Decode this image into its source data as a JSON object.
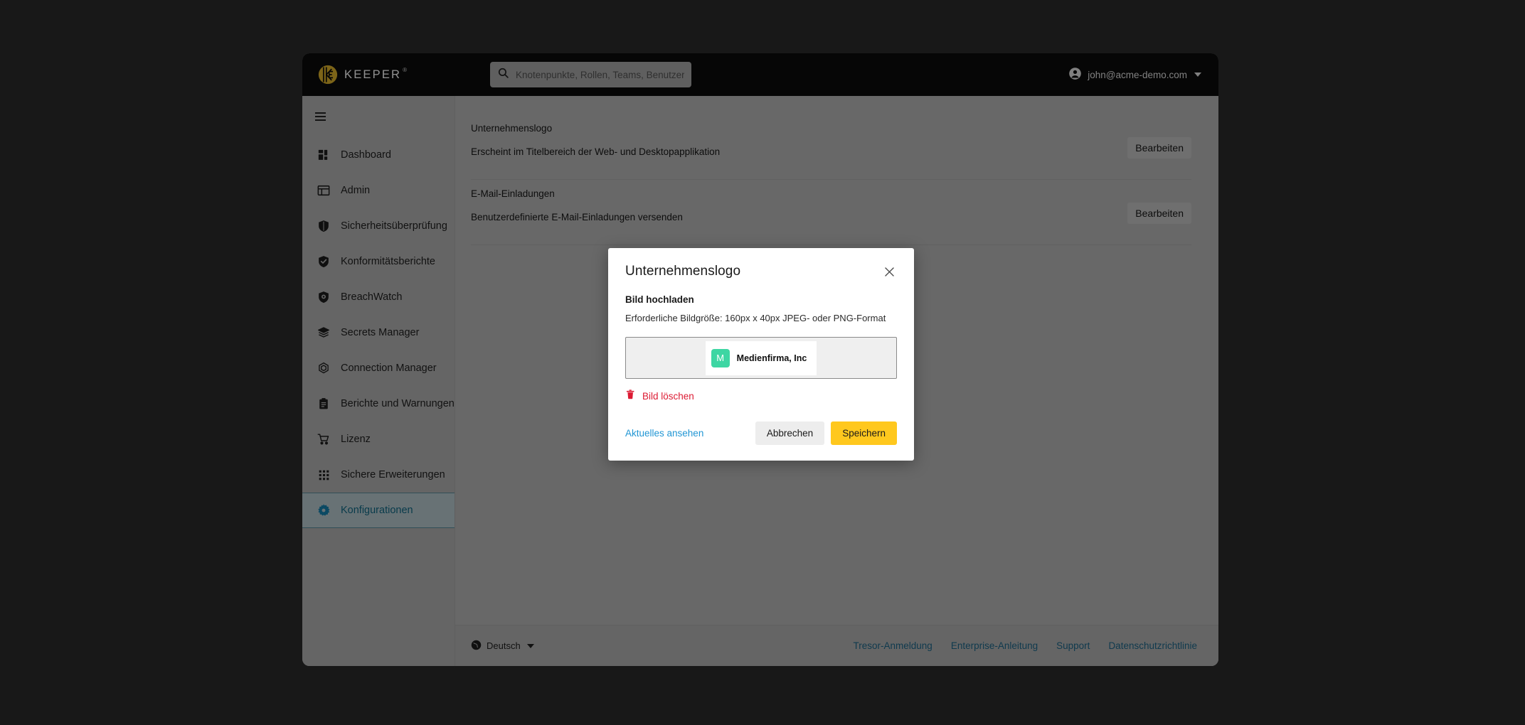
{
  "brand": {
    "name": "KEEPER",
    "trademark": "®",
    "logo_color": "#c9a227"
  },
  "topbar": {
    "search": {
      "placeholder": "Knotenpunkte, Rollen, Teams, Benutzer",
      "value": "",
      "icon": "search-icon"
    },
    "user": {
      "email": "john@acme-demo.com",
      "avatar_icon": "user-circle-icon",
      "caret_icon": "chevron-down-icon"
    }
  },
  "sidebar": {
    "menu_icon": "hamburger-icon",
    "items": [
      {
        "label": "Dashboard",
        "icon": "dashboard-grid-icon",
        "active": false
      },
      {
        "label": "Admin",
        "icon": "layout-panel-icon",
        "active": false
      },
      {
        "label": "Sicherheitsüberprüfung",
        "icon": "shield-icon",
        "active": false
      },
      {
        "label": "Konformitätsberichte",
        "icon": "shield-check-icon",
        "active": false
      },
      {
        "label": "BreachWatch",
        "icon": "shield-eye-icon",
        "active": false
      },
      {
        "label": "Secrets Manager",
        "icon": "layers-icon",
        "active": false
      },
      {
        "label": "Connection Manager",
        "icon": "hexagon-icon",
        "active": false
      },
      {
        "label": "Berichte und Warnungen",
        "icon": "clipboard-icon",
        "active": false
      },
      {
        "label": "Lizenz",
        "icon": "shopping-cart-icon",
        "active": false
      },
      {
        "label": "Sichere Erweiterungen",
        "icon": "grid-dots-icon",
        "active": false
      },
      {
        "label": "Konfigurationen",
        "icon": "gear-icon",
        "active": true
      }
    ],
    "active_color": "#0e5f7a"
  },
  "main": {
    "rows": [
      {
        "title": "Unternehmenslogo",
        "description": "Erscheint im Titelbereich der Web- und Desktopapplikation",
        "action_label": "Bearbeiten"
      },
      {
        "title": "E-Mail-Einladungen",
        "description": "Benutzerdefinierte E-Mail-Einladungen versenden",
        "action_label": "Bearbeiten"
      }
    ]
  },
  "footer": {
    "language": {
      "label": "Deutsch",
      "icon": "globe-icon",
      "caret_icon": "chevron-down-icon"
    },
    "links": [
      {
        "label": "Tresor-Anmeldung"
      },
      {
        "label": "Enterprise-Anleitung"
      },
      {
        "label": "Support"
      },
      {
        "label": "Datenschutzrichtlinie"
      }
    ],
    "link_color": "#1b5e7e"
  },
  "modal": {
    "title": "Unternehmenslogo",
    "close_icon": "close-x-icon",
    "upload_label": "Bild hochladen",
    "upload_hint": "Erforderliche Bildgröße: 160px x 40px JPEG- oder PNG-Format",
    "preview": {
      "avatar_letter": "M",
      "avatar_color": "#3dd6a3",
      "company_name": "Medienfirma, Inc"
    },
    "delete": {
      "label": "Bild löschen",
      "icon": "trash-icon",
      "color": "#dc1b33"
    },
    "view_current_label": "Aktuelles ansehen",
    "cancel_label": "Abbrechen",
    "save_label": "Speichern",
    "save_color": "#ffc81e"
  }
}
